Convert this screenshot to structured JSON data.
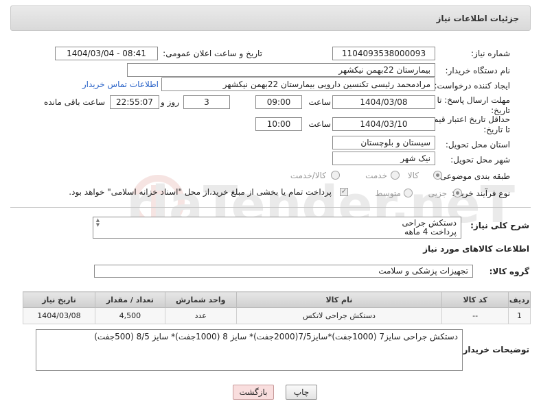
{
  "panel": {
    "title": "جزئیات اطلاعات نیاز"
  },
  "fields": {
    "need_number": {
      "label": "شماره نیاز:",
      "value": "1104093538000093"
    },
    "announce_datetime": {
      "label": "تاریخ و ساعت اعلان عمومی:",
      "value": "1404/03/04 - 08:41"
    },
    "buyer_org": {
      "label": "نام دستگاه خریدار:",
      "value": "بیمارستان 22بهمن نیکشهر"
    },
    "requester": {
      "label": "ایجاد کننده درخواست:",
      "value": "مرادمحمد رئیسی تکنسین دارویی بیمارستان 22بهمن نیکشهر"
    },
    "buyer_contact_link": "اطلاعات تماس خریدار",
    "reply_deadline": {
      "label": "مهلت ارسال پاسخ: تا تاریخ:",
      "date": "1404/03/08",
      "time_label": "ساعت",
      "time": "09:00",
      "days": "3",
      "days_label": "روز و",
      "remaining": "22:55:07",
      "remaining_label": "ساعت باقی مانده"
    },
    "price_validity": {
      "label": "حداقل تاریخ اعتبار قیمت: تا تاریخ:",
      "date": "1404/03/10",
      "time_label": "ساعت",
      "time": "10:00"
    },
    "delivery_province": {
      "label": "استان محل تحویل:",
      "value": "سیستان و بلوچستان"
    },
    "delivery_city": {
      "label": "شهر محل تحویل:",
      "value": "نیک شهر"
    },
    "category": {
      "label": "طبقه بندی موضوعی:",
      "options": [
        "کالا",
        "خدمت",
        "کالا/خدمت"
      ],
      "selected": "کالا"
    },
    "process_type": {
      "label": "نوع فرآیند خرید :",
      "options": [
        "جزیی",
        "متوسط"
      ],
      "selected": "جزیی",
      "payment_note": "پرداخت تمام یا بخشی از مبلغ خرید،از محل \"اسناد خزانه اسلامی\" خواهد بود."
    }
  },
  "description": {
    "label": "شرح کلی نیاز:",
    "line1": "دستکش جراحی",
    "line2": "پرداخت 4 ماهه"
  },
  "goods_section": {
    "title": "اطلاعات کالاهای مورد نیاز",
    "group_label": "گروه کالا:",
    "group_value": "تجهیزات پزشکی و سلامت"
  },
  "table": {
    "headers": [
      "ردیف",
      "کد کالا",
      "نام کالا",
      "واحد شمارش",
      "تعداد / مقدار",
      "تاریخ نیاز"
    ],
    "rows": [
      {
        "row": "1",
        "code": "--",
        "name": "دستکش جراحی لاتکس",
        "unit": "عدد",
        "qty": "4,500",
        "date": "1404/03/08"
      }
    ]
  },
  "buyer_notes": {
    "label": "توضیحات خریدار:",
    "value": "دستکش جراحی سایز7 (1000جفت)*سایز7/5(2000جفت)* سایز 8 (1000جفت)* سایز 8/5 (500جفت)"
  },
  "buttons": {
    "print": "چاپ",
    "back": "بازگشت"
  },
  "watermark_text": "AriaTender.neT",
  "colors": {
    "link": "#2a63c8",
    "back_button": "#f9dede",
    "header_bg": "#dcdcdc"
  }
}
